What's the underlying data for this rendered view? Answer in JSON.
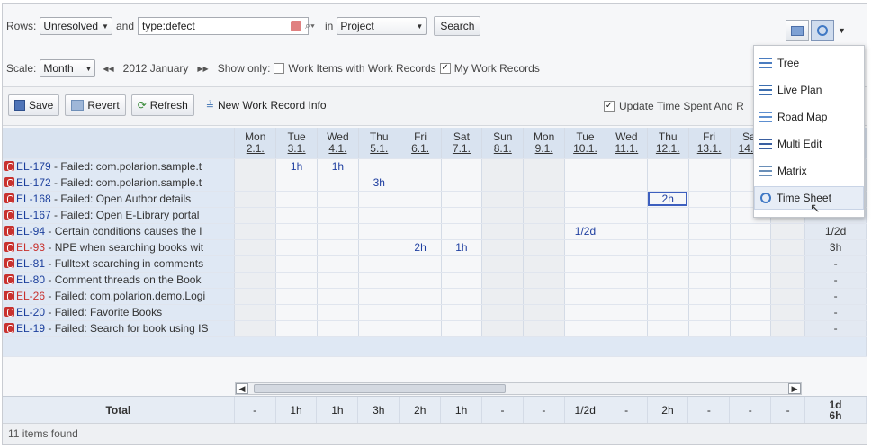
{
  "query": {
    "rows_label": "Rows:",
    "status_value": "Unresolved",
    "and_label": "and",
    "query_text": "type:defect",
    "in_label": "in",
    "scope_value": "Project",
    "search_label": "Search"
  },
  "scale": {
    "label": "Scale:",
    "value": "Month",
    "prev": "⏮◀",
    "period": "2012 January",
    "next": "▶⏭",
    "show_only_label": "Show only:",
    "work_items_label": "Work Items with Work Records",
    "my_records_label": "My Work Records"
  },
  "toolbar": {
    "save_label": "Save",
    "revert_label": "Revert",
    "refresh_label": "Refresh",
    "new_record_label": "New Work Record Info",
    "update_label": "Update Time Spent And R"
  },
  "columns": [
    {
      "day": "Mon",
      "date": "2.1."
    },
    {
      "day": "Tue",
      "date": "3.1."
    },
    {
      "day": "Wed",
      "date": "4.1."
    },
    {
      "day": "Thu",
      "date": "5.1."
    },
    {
      "day": "Fri",
      "date": "6.1."
    },
    {
      "day": "Sat",
      "date": "7.1."
    },
    {
      "day": "Sun",
      "date": "8.1."
    },
    {
      "day": "Mon",
      "date": "9.1."
    },
    {
      "day": "Tue",
      "date": "10.1."
    },
    {
      "day": "Wed",
      "date": "11.1."
    },
    {
      "day": "Thu",
      "date": "12.1."
    },
    {
      "day": "Fri",
      "date": "13.1."
    },
    {
      "day": "Sat",
      "date": "14.1."
    }
  ],
  "rows": [
    {
      "id": "EL-179",
      "title": " - Failed: com.polarion.sample.t",
      "values": [
        "",
        "1h",
        "1h",
        "",
        "",
        "",
        "",
        "",
        "",
        "",
        "",
        "",
        ""
      ],
      "total": ""
    },
    {
      "id": "EL-172",
      "title": " - Failed: com.polarion.sample.t",
      "values": [
        "",
        "",
        "",
        "3h",
        "",
        "",
        "",
        "",
        "",
        "",
        "",
        "",
        ""
      ],
      "total": ""
    },
    {
      "id": "EL-168",
      "title": " - Failed: Open Author details",
      "values": [
        "",
        "",
        "",
        "",
        "",
        "",
        "",
        "",
        "",
        "",
        "2h",
        "",
        ""
      ],
      "total": ""
    },
    {
      "id": "EL-167",
      "title": " - Failed: Open E-Library portal",
      "values": [
        "",
        "",
        "",
        "",
        "",
        "",
        "",
        "",
        "",
        "",
        "",
        "",
        ""
      ],
      "total": "-"
    },
    {
      "id": "EL-94",
      "title": " - Certain conditions causes the l",
      "values": [
        "",
        "",
        "",
        "",
        "",
        "",
        "",
        "",
        "1/2d",
        "",
        "",
        "",
        ""
      ],
      "total": "1/2d"
    },
    {
      "id": "EL-93",
      "title": " - NPE when searching books wit",
      "values": [
        "",
        "",
        "",
        "",
        "2h",
        "1h",
        "",
        "",
        "",
        "",
        "",
        "",
        ""
      ],
      "total": "3h"
    },
    {
      "id": "EL-81",
      "title": " - Fulltext searching in comments",
      "values": [
        "",
        "",
        "",
        "",
        "",
        "",
        "",
        "",
        "",
        "",
        "",
        "",
        ""
      ],
      "total": "-"
    },
    {
      "id": "EL-80",
      "title": " - Comment threads on the Book",
      "values": [
        "",
        "",
        "",
        "",
        "",
        "",
        "",
        "",
        "",
        "",
        "",
        "",
        ""
      ],
      "total": "-"
    },
    {
      "id": "EL-26",
      "title": " - Failed: com.polarion.demo.Logi",
      "values": [
        "",
        "",
        "",
        "",
        "",
        "",
        "",
        "",
        "",
        "",
        "",
        "",
        ""
      ],
      "total": "-"
    },
    {
      "id": "EL-20",
      "title": " - Failed: Favorite Books",
      "values": [
        "",
        "",
        "",
        "",
        "",
        "",
        "",
        "",
        "",
        "",
        "",
        "",
        ""
      ],
      "total": "-"
    },
    {
      "id": "EL-19",
      "title": " - Failed: Search for book using IS",
      "values": [
        "",
        "",
        "",
        "",
        "",
        "",
        "",
        "",
        "",
        "",
        "",
        "",
        ""
      ],
      "total": "-"
    }
  ],
  "totals": {
    "label": "Total",
    "values": [
      "-",
      "1h",
      "1h",
      "3h",
      "2h",
      "1h",
      "-",
      "-",
      "1/2d",
      "-",
      "2h",
      "-",
      "-",
      "-"
    ],
    "grand_total": "1d 6h"
  },
  "footer": {
    "status": "11 items found"
  },
  "view_menu": {
    "items": [
      "Tree",
      "Live Plan",
      "Road Map",
      "Multi Edit",
      "Matrix",
      "Time Sheet"
    ],
    "selected": "Time Sheet"
  },
  "colors": {
    "bug_icon": "#c8322f",
    "link": "#1c3f9c",
    "value_text": "#1f3fa0",
    "header_bg": "#d9e3f0",
    "weekend_bg": "#eceef1"
  }
}
